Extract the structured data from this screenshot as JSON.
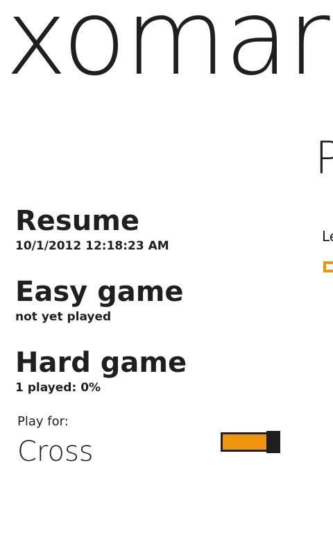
{
  "app": {
    "title": "xomar"
  },
  "next_panel": {
    "heading": "P",
    "label": "Le",
    "checkbox_color": "#f0960e"
  },
  "menu": {
    "items": [
      {
        "title": "Resume",
        "subtitle": "10/1/2012 12:18:23 AM"
      },
      {
        "title": "Easy game",
        "subtitle": "not yet played"
      },
      {
        "title": "Hard game",
        "subtitle": "1 played: 0%"
      }
    ]
  },
  "play_for": {
    "label": "Play for:",
    "value": "Cross",
    "toggle_on": true,
    "toggle_fill": 1.0,
    "accent_color": "#f0960e"
  }
}
